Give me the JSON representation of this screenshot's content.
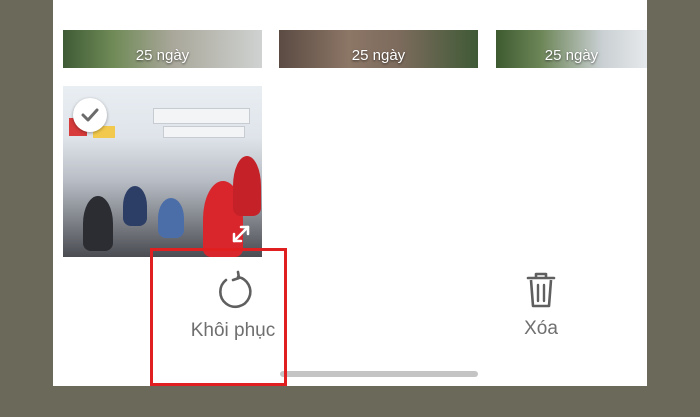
{
  "gallery": {
    "top_row": [
      {
        "days_left": "25 ngày"
      },
      {
        "days_left": "25 ngày"
      },
      {
        "days_left": "25 ngày"
      }
    ]
  },
  "actions": {
    "restore_label": "Khôi phục",
    "delete_label": "Xóa"
  },
  "colors": {
    "highlight": "#e02020",
    "background": "#6b6a5a"
  },
  "icons": [
    "check-icon",
    "expand-icon",
    "restore-icon",
    "trash-icon"
  ]
}
